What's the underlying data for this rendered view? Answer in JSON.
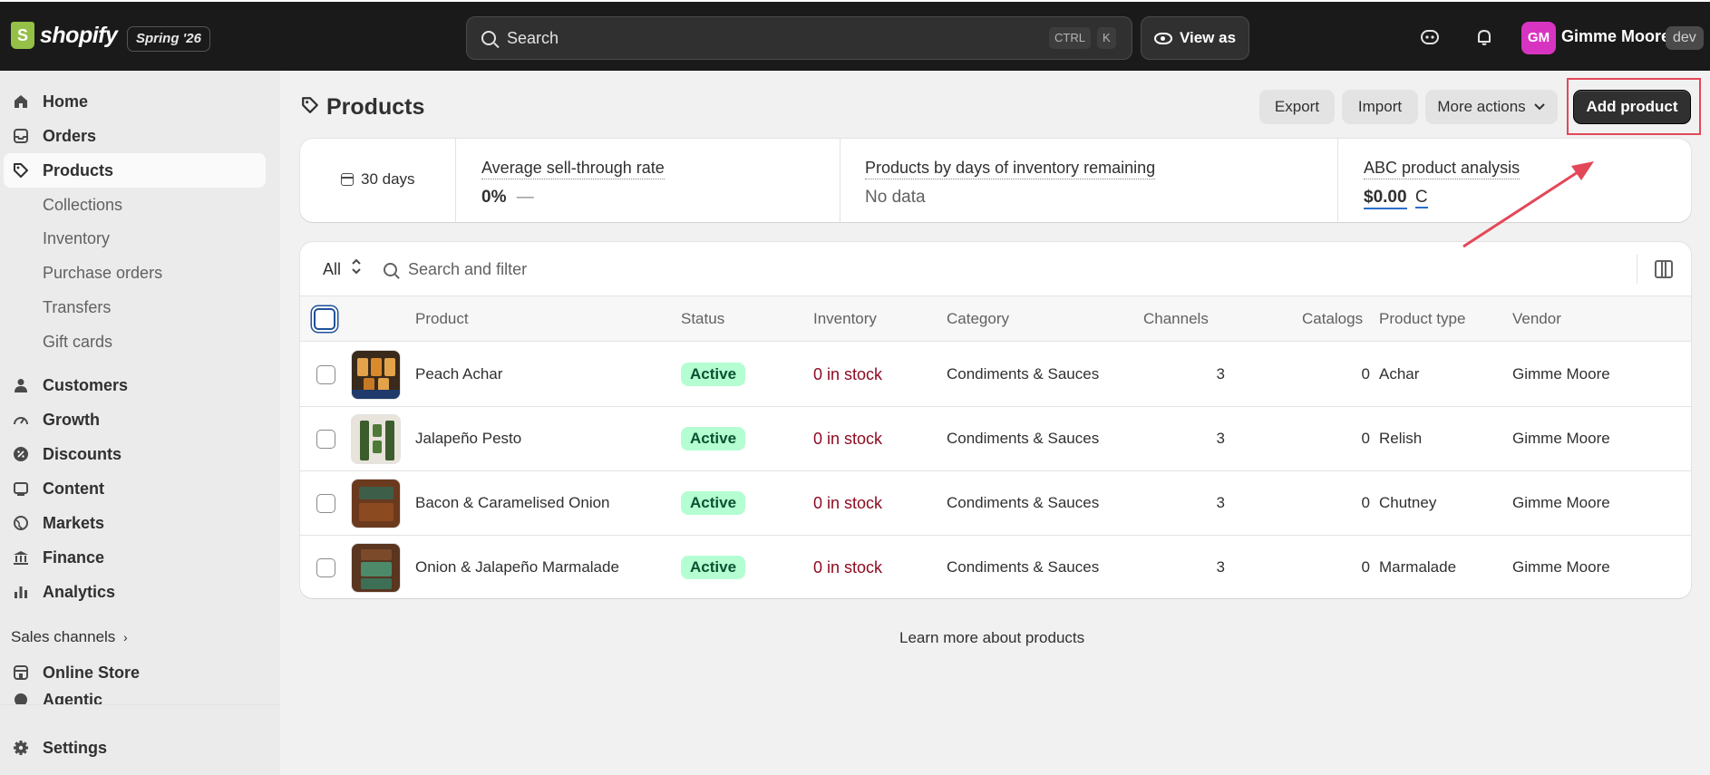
{
  "topbar": {
    "brand": "shopify",
    "edition": "Spring '26",
    "search_placeholder": "Search",
    "shortcut_ctrl": "CTRL",
    "shortcut_k": "K",
    "view_as_label": "View as",
    "avatar_initials": "GM",
    "user_name": "Gimme Moore",
    "dev_badge": "dev"
  },
  "sidebar": {
    "items": [
      {
        "label": "Home",
        "icon": "home-icon"
      },
      {
        "label": "Orders",
        "icon": "inbox-icon"
      },
      {
        "label": "Products",
        "icon": "tag-icon",
        "active": true
      },
      {
        "label": "Customers",
        "icon": "person-icon"
      },
      {
        "label": "Growth",
        "icon": "gauge-icon"
      },
      {
        "label": "Discounts",
        "icon": "discount-icon"
      },
      {
        "label": "Content",
        "icon": "content-icon"
      },
      {
        "label": "Markets",
        "icon": "globe-icon"
      },
      {
        "label": "Finance",
        "icon": "bank-icon"
      },
      {
        "label": "Analytics",
        "icon": "bar-chart-icon"
      }
    ],
    "sub_items": [
      "Collections",
      "Inventory",
      "Purchase orders",
      "Transfers",
      "Gift cards"
    ],
    "sales_channels_label": "Sales channels",
    "channels": [
      {
        "label": "Online Store",
        "icon": "store-icon"
      },
      {
        "label": "Agentic",
        "icon": "agentic-icon"
      }
    ],
    "settings_label": "Settings"
  },
  "page": {
    "title": "Products",
    "export_label": "Export",
    "import_label": "Import",
    "more_actions_label": "More actions",
    "add_product_label": "Add product",
    "learn_more": "Learn more about products"
  },
  "metrics": {
    "period": "30 days",
    "cards": [
      {
        "title": "Average sell-through rate",
        "value": "0%",
        "suffix": "—"
      },
      {
        "title": "Products by days of inventory remaining",
        "value": "No data"
      },
      {
        "title": "ABC product analysis",
        "value": "$0.00",
        "suffix": "C"
      }
    ]
  },
  "table": {
    "filter_all": "All",
    "filter_placeholder": "Search and filter",
    "columns": [
      "Product",
      "Status",
      "Inventory",
      "Category",
      "Channels",
      "Catalogs",
      "Product type",
      "Vendor"
    ],
    "rows": [
      {
        "product": "Peach Achar",
        "status": "Active",
        "inventory": "0 in stock",
        "category": "Condiments & Sauces",
        "channels": "3",
        "catalogs": "0",
        "type": "Achar",
        "vendor": "Gimme Moore"
      },
      {
        "product": "Jalapeño Pesto",
        "status": "Active",
        "inventory": "0 in stock",
        "category": "Condiments & Sauces",
        "channels": "3",
        "catalogs": "0",
        "type": "Relish",
        "vendor": "Gimme Moore"
      },
      {
        "product": "Bacon & Caramelised Onion",
        "status": "Active",
        "inventory": "0 in stock",
        "category": "Condiments & Sauces",
        "channels": "3",
        "catalogs": "0",
        "type": "Chutney",
        "vendor": "Gimme Moore"
      },
      {
        "product": "Onion & Jalapeño Marmalade",
        "status": "Active",
        "inventory": "0 in stock",
        "category": "Condiments & Sauces",
        "channels": "3",
        "catalogs": "0",
        "type": "Marmalade",
        "vendor": "Gimme Moore"
      }
    ]
  },
  "colors": {
    "topbar": "#1a1a1a",
    "active_badge_bg": "#b4fed2",
    "active_badge_text": "#0c5132",
    "stock_text": "#8e0b21",
    "annotation": "#e34858",
    "avatar": "#d834c2"
  }
}
